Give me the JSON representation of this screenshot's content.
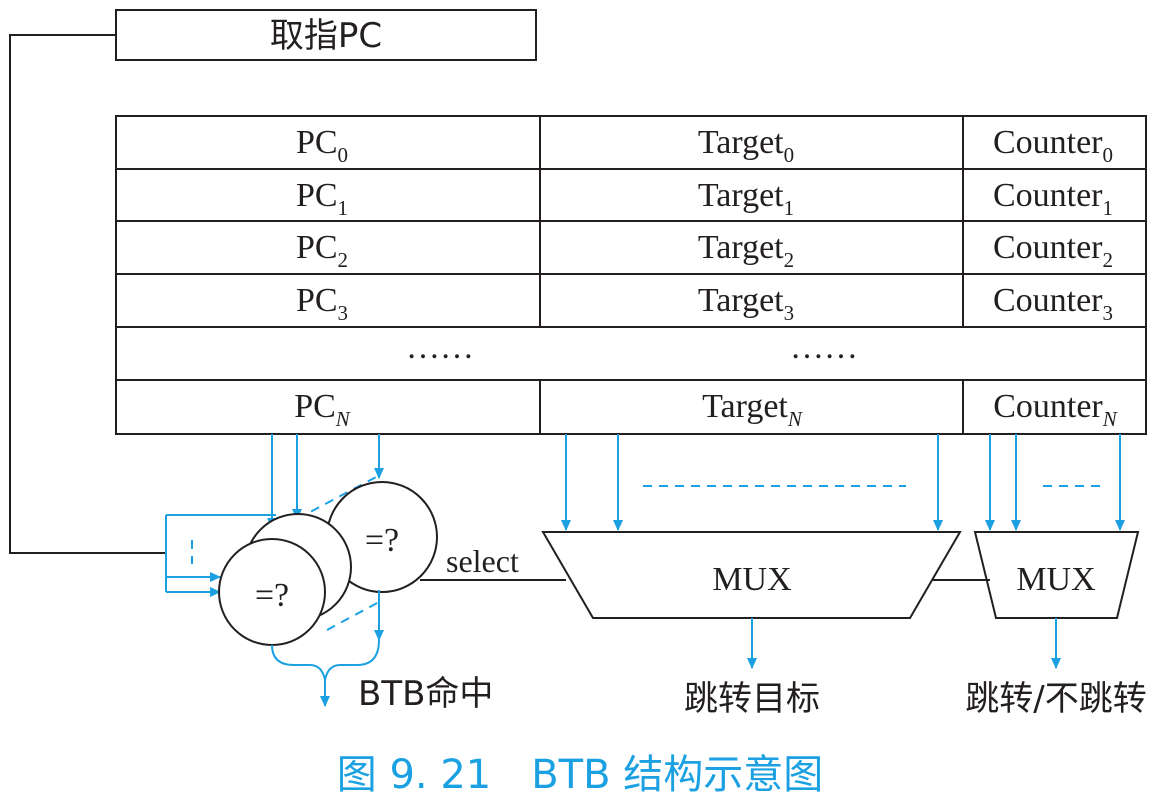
{
  "fetch_pc": {
    "label": "取指PC"
  },
  "btb": {
    "rows": [
      {
        "pc": "PC",
        "pc_sub": "0",
        "target": "Target",
        "target_sub": "0",
        "counter": "Counter",
        "counter_sub": "0"
      },
      {
        "pc": "PC",
        "pc_sub": "1",
        "target": "Target",
        "target_sub": "1",
        "counter": "Counter",
        "counter_sub": "1"
      },
      {
        "pc": "PC",
        "pc_sub": "2",
        "target": "Target",
        "target_sub": "2",
        "counter": "Counter",
        "counter_sub": "2"
      },
      {
        "pc": "PC",
        "pc_sub": "3",
        "target": "Target",
        "target_sub": "3",
        "counter": "Counter",
        "counter_sub": "3"
      }
    ],
    "ellipsis_pc": "……",
    "ellipsis_target": "……",
    "last_row": {
      "pc": "PC",
      "pc_sub": "N",
      "target": "Target",
      "target_sub": "N",
      "counter": "Counter",
      "counter_sub": "N"
    }
  },
  "comparators": {
    "label_front": "=?",
    "label_back": "=?"
  },
  "select_label": "select",
  "mux_target": {
    "label": "MUX",
    "output": "跳转目标"
  },
  "mux_counter": {
    "label": "MUX",
    "output": "跳转/不跳转"
  },
  "hit_label": "BTB命中",
  "caption": "图 9. 21　BTB 结构示意图",
  "colors": {
    "line": "#231f20",
    "accent": "#1ba1e2"
  }
}
